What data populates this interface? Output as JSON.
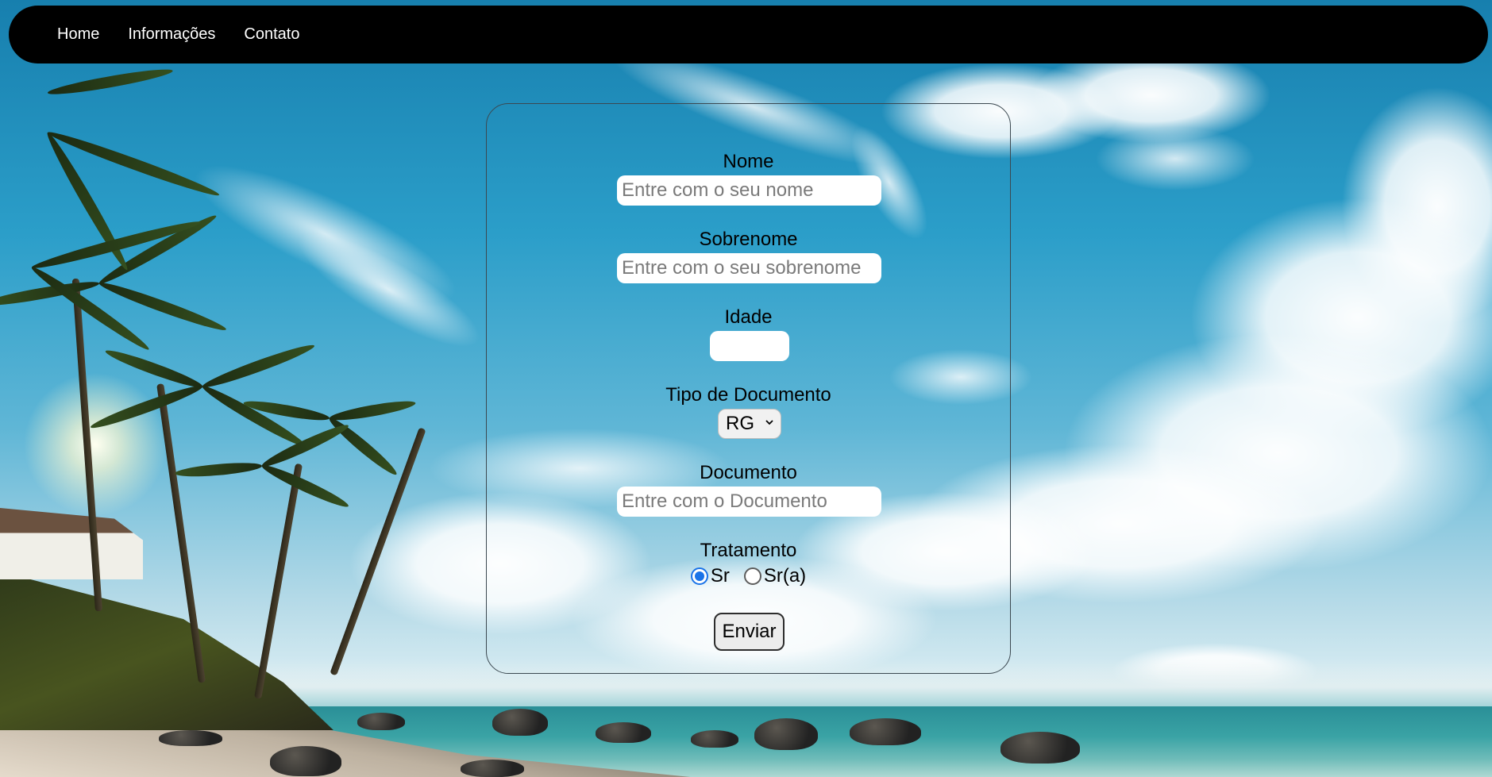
{
  "nav": {
    "items": [
      {
        "label": "Home"
      },
      {
        "label": "Informações"
      },
      {
        "label": "Contato"
      }
    ]
  },
  "form": {
    "nome": {
      "label": "Nome",
      "placeholder": "Entre com o seu nome",
      "value": ""
    },
    "sobrenome": {
      "label": "Sobrenome",
      "placeholder": "Entre com o seu sobrenome",
      "value": ""
    },
    "idade": {
      "label": "Idade",
      "value": ""
    },
    "tipo_documento": {
      "label": "Tipo de Documento",
      "selected": "RG"
    },
    "documento": {
      "label": "Documento",
      "placeholder": "Entre com o Documento",
      "value": ""
    },
    "tratamento": {
      "label": "Tratamento",
      "options": [
        {
          "label": "Sr",
          "checked": true
        },
        {
          "label": "Sr(a)",
          "checked": false
        }
      ]
    },
    "submit_label": "Enviar"
  },
  "colors": {
    "navbar_bg": "#000000",
    "nav_text": "#ffffff",
    "radio_accent": "#1a73e8"
  }
}
